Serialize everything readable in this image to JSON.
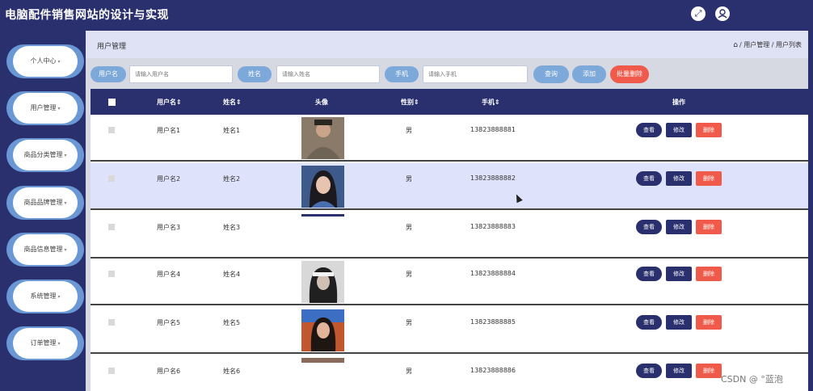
{
  "app": {
    "title": "电脑配件销售网站的设计与实现"
  },
  "header": {
    "fullscreen_icon": "fullscreen-icon",
    "user_icon": "user-icon"
  },
  "sidebar": {
    "items": [
      {
        "label": "个人中心"
      },
      {
        "label": "用户管理"
      },
      {
        "label": "商品分类管理"
      },
      {
        "label": "商品品牌管理"
      },
      {
        "label": "商品信息管理"
      },
      {
        "label": "系统管理"
      },
      {
        "label": "订单管理"
      }
    ]
  },
  "breadcrumb": {
    "title": "用户管理",
    "home_icon": "home-icon",
    "path": "/ 用户管理 / 用户列表"
  },
  "search": {
    "username_label": "用户名",
    "username_placeholder": "请输入用户名",
    "name_label": "姓名",
    "name_placeholder": "请输入姓名",
    "phone_label": "手机",
    "phone_placeholder": "请输入手机",
    "query_label": "查询",
    "add_label": "添加",
    "batch_delete_label": "批量删除"
  },
  "table": {
    "columns": [
      "用户名",
      "姓名",
      "头像",
      "性别",
      "手机",
      "操作"
    ],
    "rows": [
      {
        "username": "用户名1",
        "name": "姓名1",
        "gender": "男",
        "phone": "13823888881",
        "avatar": "avatar-photo",
        "highlighted": false
      },
      {
        "username": "用户名2",
        "name": "姓名2",
        "gender": "男",
        "phone": "13823888882",
        "avatar": "avatar-photo",
        "highlighted": true
      },
      {
        "username": "用户名3",
        "name": "姓名3",
        "gender": "男",
        "phone": "13823888883",
        "avatar": "avatar-missing",
        "highlighted": false
      },
      {
        "username": "用户名4",
        "name": "姓名4",
        "gender": "男",
        "phone": "13823888884",
        "avatar": "avatar-photo",
        "highlighted": false
      },
      {
        "username": "用户名5",
        "name": "姓名5",
        "gender": "男",
        "phone": "13823888885",
        "avatar": "avatar-photo",
        "highlighted": false
      },
      {
        "username": "用户名6",
        "name": "姓名6",
        "gender": "男",
        "phone": "13823888886",
        "avatar": "avatar-photo",
        "highlighted": false
      }
    ],
    "actions": {
      "view": "查看",
      "edit": "修改",
      "delete": "删除"
    }
  },
  "watermark": "CSDN @ °蓝泡",
  "colors": {
    "navy": "#2a2f6e",
    "accent_blue": "#7ca9d9",
    "danger": "#f05a4a",
    "highlight_row": "#dfe2fb"
  }
}
